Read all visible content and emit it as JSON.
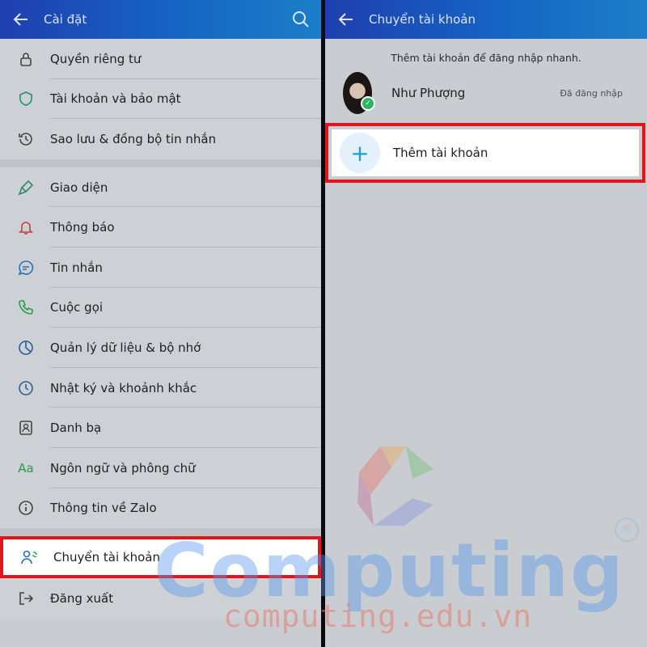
{
  "left": {
    "header": {
      "title": "Cài đặt",
      "back_icon": "arrow-left-icon",
      "search_icon": "search-icon"
    },
    "groups": [
      [
        {
          "label": "Quyền riêng tư",
          "icon": "lock-icon"
        },
        {
          "label": "Tài khoản và bảo mật",
          "icon": "shield-icon"
        },
        {
          "label": "Sao lưu & đồng bộ tin nhắn",
          "icon": "history-icon"
        }
      ],
      [
        {
          "label": "Giao diện",
          "icon": "brush-icon"
        },
        {
          "label": "Thông báo",
          "icon": "bell-icon"
        },
        {
          "label": "Tin nhắn",
          "icon": "chat-icon"
        },
        {
          "label": "Cuộc gọi",
          "icon": "phone-icon"
        },
        {
          "label": "Quản lý dữ liệu & bộ nhớ",
          "icon": "pie-chart-icon"
        },
        {
          "label": "Nhật ký và khoảnh khắc",
          "icon": "clock-icon"
        },
        {
          "label": "Danh bạ",
          "icon": "contact-icon"
        },
        {
          "label": "Ngôn ngữ và phông chữ",
          "icon": "font-icon"
        },
        {
          "label": "Thông tin về Zalo",
          "icon": "info-icon"
        }
      ]
    ],
    "switch_account": {
      "label": "Chuyển tài khoản",
      "icon": "switch-user-icon"
    },
    "logout": {
      "label": "Đăng xuất",
      "icon": "logout-icon"
    }
  },
  "right": {
    "header": {
      "title": "Chuyển tài khoản",
      "back_icon": "arrow-left-icon"
    },
    "note": "Thêm tài khoản để đăng nhập nhanh.",
    "account": {
      "name": "Như Phượng",
      "status": "Đã đăng nhập"
    },
    "add_account": {
      "label": "Thêm tài khoản",
      "icon": "plus-icon"
    }
  },
  "watermark": {
    "brand": "Computing",
    "site": "computing.edu.vn",
    "reg": "®"
  },
  "colors": {
    "header_start": "#1f3fae",
    "header_end": "#1b7ec9",
    "highlight": "#e1151b",
    "accent": "#1aa0d7",
    "check": "#2db463"
  }
}
